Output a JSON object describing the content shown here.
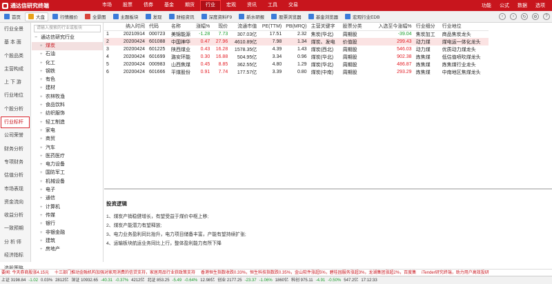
{
  "app": {
    "title": "通达信研究终端"
  },
  "top_menu": [
    {
      "label": "市场",
      "active": false
    },
    {
      "label": "股票",
      "active": false
    },
    {
      "label": "债券",
      "active": false
    },
    {
      "label": "基金",
      "active": false
    },
    {
      "label": "期货",
      "active": false
    },
    {
      "label": "行业",
      "active": true
    },
    {
      "label": "宏观",
      "active": false
    },
    {
      "label": "资讯",
      "active": false
    },
    {
      "label": "工具",
      "active": false
    },
    {
      "label": "交易",
      "active": false
    }
  ],
  "window_controls": [
    "功能",
    "公式",
    "数据",
    "选项"
  ],
  "toolbar": [
    {
      "label": "首页",
      "icon": "home-icon",
      "color": "#3b7bd9",
      "active": false
    },
    {
      "label": "大盘",
      "icon": "market-icon",
      "color": "#e8a21a",
      "active": true
    },
    {
      "label": "行情报价",
      "icon": "quote-icon",
      "color": "#3b7bd9",
      "active": false
    },
    {
      "label": "全景图",
      "icon": "panorama-icon",
      "color": "#d9453b",
      "active": false
    },
    {
      "label": "主题板块",
      "icon": "theme-icon",
      "color": "#3b7bd9",
      "active": false
    },
    {
      "label": "发现",
      "icon": "discover-icon",
      "color": "#3b7bd9",
      "active": false
    },
    {
      "label": "财经资讯",
      "icon": "news-icon",
      "color": "#3b7bd9",
      "active": false
    },
    {
      "label": "深度资料F9",
      "icon": "data-icon",
      "color": "#3b7bd9",
      "active": false
    },
    {
      "label": "新水研报",
      "icon": "report-icon",
      "color": "#3b7bd9",
      "active": false
    },
    {
      "label": "股票浏览器",
      "icon": "stock-browser-icon",
      "color": "#3b7bd9",
      "active": false
    },
    {
      "label": "基金浏览器",
      "icon": "fund-browser-icon",
      "color": "#3b7bd9",
      "active": false
    },
    {
      "label": "宏观行业EDB",
      "icon": "edb-icon",
      "color": "#3b7bd9",
      "active": false
    }
  ],
  "left_nav": [
    {
      "label": "行业全景",
      "active": false
    },
    {
      "label": "基 本 面",
      "active": false
    },
    {
      "label": "个股品类",
      "active": false
    },
    {
      "label": "主营构成",
      "active": false
    },
    {
      "label": "上 下 游",
      "active": false
    },
    {
      "label": "行业地位",
      "active": false
    },
    {
      "label": "个股分析",
      "active": false
    },
    {
      "label": "行业标杆",
      "active": true
    },
    {
      "label": "公司荣誉",
      "active": false
    },
    {
      "label": "财务分析",
      "active": false
    },
    {
      "label": "专项财务",
      "active": false
    },
    {
      "label": "估值分析",
      "active": false
    },
    {
      "label": "市场表现",
      "active": false
    },
    {
      "label": "资金流向",
      "active": false
    },
    {
      "label": "收益分析",
      "active": false
    },
    {
      "label": "一致预期",
      "active": false
    },
    {
      "label": "分 析 师",
      "active": false
    },
    {
      "label": "经济指标",
      "active": false
    },
    {
      "label": "选股策略",
      "active": false
    }
  ],
  "tree": {
    "search_placeholder": "请输入搜索的行业或板块",
    "root": "通达信研究行业",
    "nodes": [
      {
        "label": "煤炭",
        "selected": true
      },
      {
        "label": "石油",
        "selected": false
      },
      {
        "label": "化工",
        "selected": false
      },
      {
        "label": "钢铁",
        "selected": false
      },
      {
        "label": "有色",
        "selected": false
      },
      {
        "label": "建材",
        "selected": false
      },
      {
        "label": "农林牧渔",
        "selected": false
      },
      {
        "label": "食品饮料",
        "selected": false
      },
      {
        "label": "纺织服饰",
        "selected": false
      },
      {
        "label": "轻工制造",
        "selected": false
      },
      {
        "label": "家电",
        "selected": false
      },
      {
        "label": "商贸",
        "selected": false
      },
      {
        "label": "汽车",
        "selected": false
      },
      {
        "label": "医药医疗",
        "selected": false
      },
      {
        "label": "电力设备",
        "selected": false
      },
      {
        "label": "国防军工",
        "selected": false
      },
      {
        "label": "机械设备",
        "selected": false
      },
      {
        "label": "电子",
        "selected": false
      },
      {
        "label": "通信",
        "selected": false
      },
      {
        "label": "计算机",
        "selected": false
      },
      {
        "label": "传媒",
        "selected": false
      },
      {
        "label": "银行",
        "selected": false
      },
      {
        "label": "非银金融",
        "selected": false
      },
      {
        "label": "建筑",
        "selected": false
      },
      {
        "label": "房地产",
        "selected": false
      }
    ]
  },
  "table": {
    "headers": [
      "",
      "纳入时间",
      "代码",
      "名称",
      "涨幅%",
      "现价",
      "流通市值",
      "PE(TTM)",
      "PB(MRQ)",
      "主营关键字",
      "股票分类",
      "入选至今涨幅%",
      "行业细分",
      "行业地位"
    ],
    "rows": [
      [
        "1",
        "20210914",
        "000723",
        "美锦能源",
        "-1.28",
        "7.73",
        "307.03亿",
        "17.51",
        "2.32",
        "焦炭(华北)",
        "周期股",
        "-39.04",
        "焦炭加工",
        "商品焦炭龙头"
      ],
      [
        "2",
        "20200424",
        "601088",
        "中国神华",
        "0.47",
        "27.96",
        "4610.89亿",
        "7.98",
        "1.34",
        "煤炭、发电",
        "价值股",
        "299.43",
        "动力煤",
        "煤电运一体化龙头"
      ],
      [
        "3",
        "20200424",
        "601225",
        "陕西煤业",
        "0.43",
        "16.28",
        "1578.35亿",
        "4.39",
        "1.43",
        "煤炭(西北)",
        "周期股",
        "546.03",
        "动力煤",
        "优质动力煤龙头"
      ],
      [
        "4",
        "20200424",
        "601699",
        "潞安环能",
        "0.30",
        "16.88",
        "504.95亿",
        "3.34",
        "0.96",
        "煤炭(华北)",
        "周期股",
        "902.38",
        "炼焦煤",
        "低估值喷吹煤龙头"
      ],
      [
        "5",
        "20200424",
        "000983",
        "山西焦煤",
        "0.45",
        "8.85",
        "362.55亿",
        "4.80",
        "1.29",
        "煤炭(华北)",
        "周期股",
        "486.87",
        "炼焦煤",
        "炼焦煤行业龙头"
      ],
      [
        "6",
        "20200424",
        "601666",
        "平煤股份",
        "0.91",
        "7.74",
        "177.57亿",
        "3.39",
        "0.80",
        "煤炭(中南)",
        "周期股",
        "293.29",
        "炼焦煤",
        "中南地区焦煤龙头"
      ]
    ]
  },
  "logic": {
    "title": "投资逻辑",
    "lines": [
      "1、煤炭产销稳健增长，有望受益于煤价中枢上移;",
      "2、煤炭产能潜力有望释放;",
      "3、电力业务盈利同比抬升，电力项目储备丰富，产能有望持续扩张;",
      "4、运输板块航运业务同比上行，整体盈利能力有所下降"
    ]
  },
  "ticker": [
    {
      "text": "要闻: 今天券商股涨4.15元",
      "tone": "red"
    },
    {
      "text": "十三部门推动金融机构加强对家用消费的信贷支持，家居用品行业获政策支持",
      "tone": "red"
    },
    {
      "text": "香港恒生指数收跌0.33%，恒生科技指数跌0.35%，金山软件涨超5%，碧桂园服务涨超3%，龙湖集团涨超2%，百度集",
      "tone": "red"
    },
    {
      "text": "iTender研究终端，助力用户高效投研",
      "tone": "red"
    }
  ],
  "status": [
    "上证 3198.84",
    "-1.02",
    "0.03%",
    "2812亿",
    "深证 10932.65",
    "-40.31",
    "-0.37%",
    "4212亿",
    "北证 853.25",
    "-5.49",
    "-0.64%",
    "12.98亿",
    "创业 2177.25",
    "-23.37",
    "-1.06%",
    "1860亿",
    "科创 975.11",
    "-4.91",
    "-0.50%",
    "547.2亿",
    "17:12:33"
  ]
}
